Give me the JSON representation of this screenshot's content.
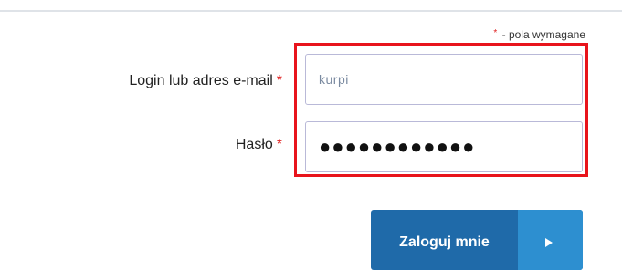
{
  "form": {
    "required_note": {
      "marker": "*",
      "text": " - pola wymagane"
    },
    "fields": [
      {
        "label": "Login lub adres e-mail",
        "required_marker": "*",
        "value": "kurpi"
      },
      {
        "label": "Hasło",
        "required_marker": "*",
        "value": "●●●●●●●●●●●●"
      }
    ],
    "submit": {
      "label": "Zaloguj mnie",
      "icon": "play-arrow-icon"
    }
  },
  "colors": {
    "highlight": "#e8141c",
    "required": "#e02020",
    "button": "#1f6aa9",
    "button_arrow": "#2d8fd0"
  }
}
